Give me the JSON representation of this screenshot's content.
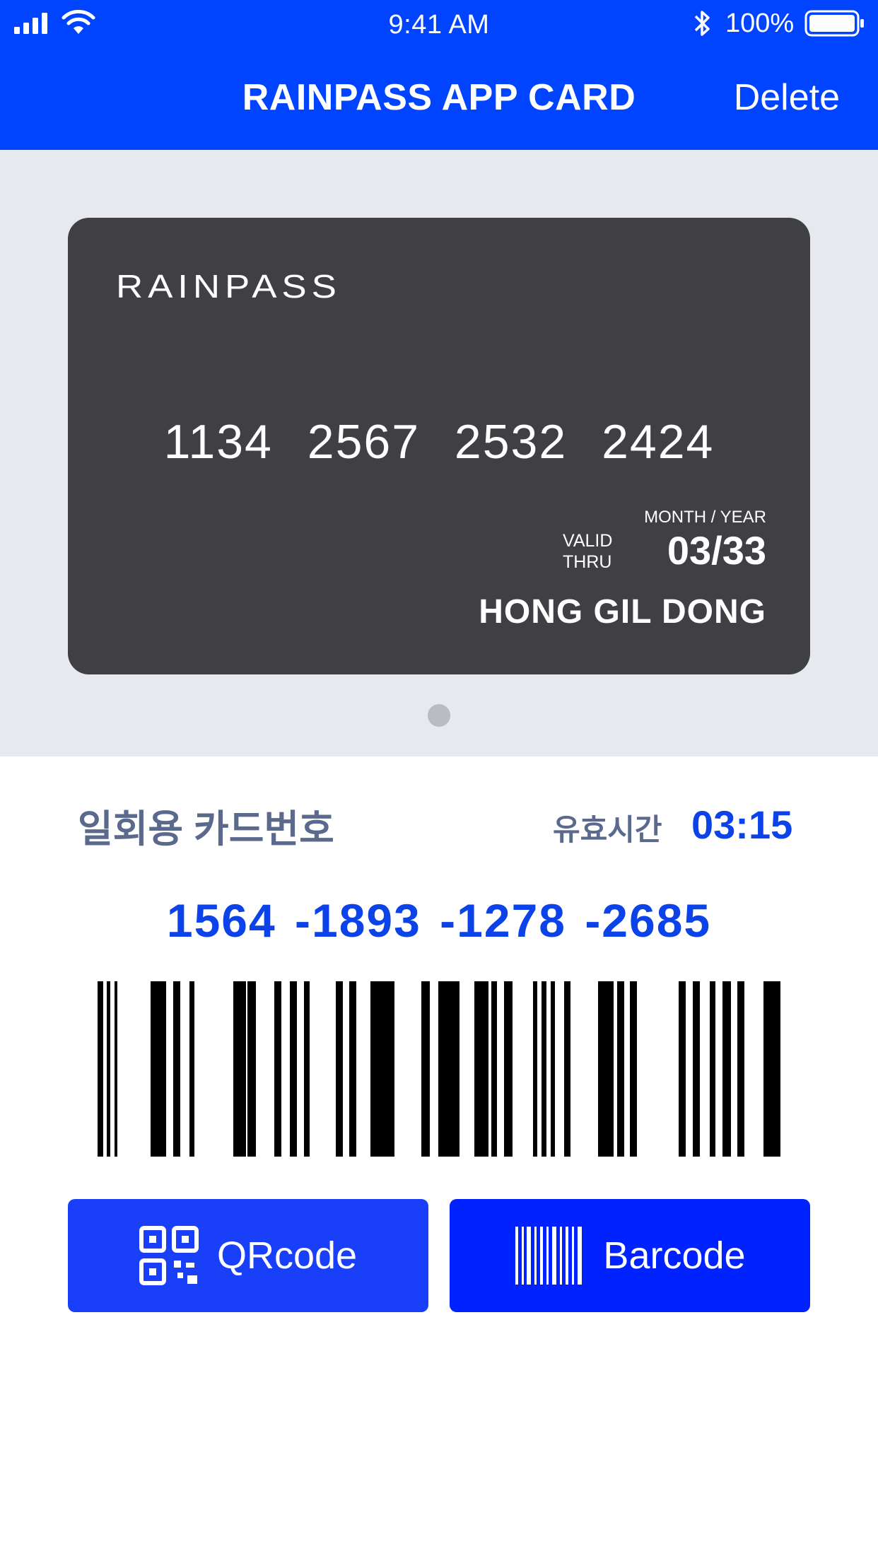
{
  "status_bar": {
    "time": "9:41 AM",
    "battery_percent": "100%",
    "icons": [
      "signal-icon",
      "wifi-icon",
      "bluetooth-icon",
      "battery-icon"
    ]
  },
  "nav": {
    "title": "RAINPASS APP CARD",
    "delete_label": "Delete"
  },
  "card": {
    "brand": "RAINPASS",
    "number": "1134 2567 2532 2424",
    "valid_thru_line1": "VALID",
    "valid_thru_line2": "THRU",
    "month_year_label": "MONTH / YEAR",
    "expiry": "03/33",
    "holder": "HONG GIL DONG"
  },
  "pager": {
    "count": 1,
    "active": 0
  },
  "otp": {
    "label": "일회용 카드번호",
    "valid_time_label": "유효시간",
    "valid_time": "03:15",
    "number": "1564 -1893 -1278 -2685"
  },
  "buttons": {
    "qr_label": "QRcode",
    "barcode_label": "Barcode"
  },
  "colors": {
    "header": "#0044ff",
    "card_area": "#e6e9ed",
    "card": "#3f3f44",
    "accent_text": "#0b43e8",
    "muted_text": "#5b6a8c",
    "qr_button": "#1a3ff8",
    "barcode_button": "#0022ff"
  }
}
